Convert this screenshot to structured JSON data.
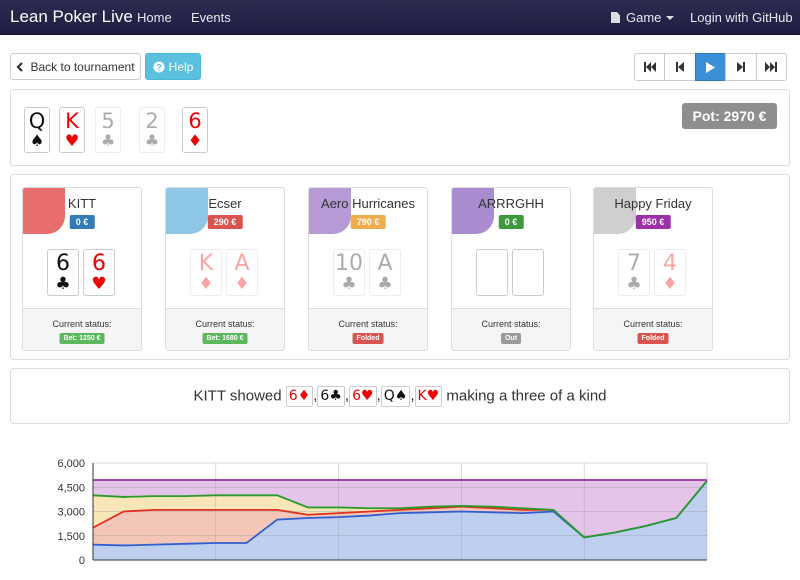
{
  "navbar": {
    "brand": "Lean Poker Live",
    "home": "Home",
    "events": "Events",
    "game": "Game",
    "login": "Login with GitHub"
  },
  "toolbar": {
    "back_label": "Back to tournament",
    "help_label": "Help"
  },
  "board": {
    "cards": [
      {
        "rank": "Q",
        "suit": "♠",
        "color": "black",
        "faded": false
      },
      {
        "rank": "K",
        "suit": "♥",
        "color": "red",
        "faded": false
      },
      {
        "rank": "5",
        "suit": "♣",
        "color": "black",
        "faded": true
      },
      {
        "rank": "2",
        "suit": "♣",
        "color": "black",
        "faded": true
      },
      {
        "rank": "6",
        "suit": "♦",
        "color": "red",
        "faded": false
      }
    ],
    "pot": "Pot: 2970 €"
  },
  "players": [
    {
      "name": "KITT",
      "stack": "0 €",
      "stack_color": "#337ab7",
      "avatar_color": "#e86e6e",
      "cards": [
        {
          "rank": "6",
          "suit": "♣",
          "color": "black",
          "faded": false
        },
        {
          "rank": "6",
          "suit": "♥",
          "color": "red",
          "faded": false
        }
      ],
      "status_label": "Current status:",
      "status": "Bet: 1250 €",
      "status_color": "#5cb85c"
    },
    {
      "name": "Ecser",
      "stack": "290 €",
      "stack_color": "#d9534f",
      "avatar_color": "#8ec7e6",
      "cards": [
        {
          "rank": "K",
          "suit": "♦",
          "color": "red",
          "faded": true
        },
        {
          "rank": "A",
          "suit": "♦",
          "color": "red",
          "faded": true
        }
      ],
      "status_label": "Current status:",
      "status": "Bet: 1680 €",
      "status_color": "#5cb85c"
    },
    {
      "name": "Aero Hurricanes",
      "stack": "790 €",
      "stack_color": "#f0ad4e",
      "avatar_color": "#b59ad6",
      "cards": [
        {
          "rank": "10",
          "suit": "♣",
          "color": "black",
          "faded": true
        },
        {
          "rank": "A",
          "suit": "♣",
          "color": "black",
          "faded": true
        }
      ],
      "status_label": "Current status:",
      "status": "Folded",
      "status_color": "#d9534f"
    },
    {
      "name": "ARRRGHH",
      "stack": "0 €",
      "stack_color": "#3c9a3c",
      "avatar_color": "#a98bd0",
      "cards": [],
      "status_label": "Current status:",
      "status": "Out",
      "status_color": "#999999"
    },
    {
      "name": "Happy Friday",
      "stack": "950 €",
      "stack_color": "#9b30a8",
      "avatar_color": "#cfcfcf",
      "cards": [
        {
          "rank": "7",
          "suit": "♣",
          "color": "black",
          "faded": true
        },
        {
          "rank": "4",
          "suit": "♦",
          "color": "red",
          "faded": true
        }
      ],
      "status_label": "Current status:",
      "status": "Folded",
      "status_color": "#d9534f"
    }
  ],
  "showdown": {
    "player": "KITT",
    "verb": "showed",
    "cards": [
      {
        "rank": "6",
        "suit": "♦",
        "color": "red"
      },
      {
        "rank": "6",
        "suit": "♣",
        "color": "black"
      },
      {
        "rank": "6",
        "suit": "♥",
        "color": "red"
      },
      {
        "rank": "Q",
        "suit": "♠",
        "color": "black"
      },
      {
        "rank": "K",
        "suit": "♥",
        "color": "red"
      }
    ],
    "result": "making a three of a kind"
  },
  "icons": {
    "back": "chevron-left-icon",
    "help": "question-circle-icon",
    "game": "file-icon"
  },
  "chart_data": {
    "type": "area",
    "title": "",
    "ylim": [
      0,
      6000
    ],
    "yticks": [
      "0",
      "1,500",
      "3,000",
      "4,500",
      "6,000"
    ],
    "x": [
      0,
      1,
      2,
      3,
      4,
      5,
      6,
      7,
      8,
      9,
      10,
      11,
      12,
      13,
      14,
      15,
      16,
      17,
      18,
      19,
      20
    ],
    "series": [
      {
        "color": "#2f5fd0",
        "fill": "#bfcff0",
        "values": [
          950,
          900,
          950,
          1000,
          1050,
          1050,
          2500,
          2600,
          2650,
          2750,
          2900,
          2950,
          3000,
          2950,
          2900,
          3000,
          1400,
          1700,
          2100,
          2600,
          4900
        ]
      },
      {
        "color": "#e03020",
        "fill": "#f4c6b8",
        "values": [
          2000,
          3000,
          3100,
          3100,
          3100,
          3100,
          3100,
          2800,
          2900,
          3000,
          3100,
          3200,
          3300,
          3200,
          3100,
          3100,
          null,
          null,
          null,
          null,
          null
        ]
      },
      {
        "color": "#2a9a2a",
        "fill": "#f8e6b8",
        "values": [
          4000,
          3900,
          3950,
          3950,
          4000,
          4000,
          4000,
          3250,
          3250,
          3200,
          3200,
          3300,
          3350,
          3300,
          3200,
          3100,
          1400,
          1700,
          2100,
          2600,
          4900
        ]
      },
      {
        "color": "#9b2fa8",
        "fill": "#e4c4e8",
        "values": [
          4950,
          4950,
          4950,
          4950,
          4950,
          4950,
          4950,
          4950,
          4950,
          4950,
          4950,
          4950,
          4950,
          4950,
          4950,
          4950,
          4950,
          4950,
          4950,
          4950,
          4950
        ]
      }
    ]
  }
}
